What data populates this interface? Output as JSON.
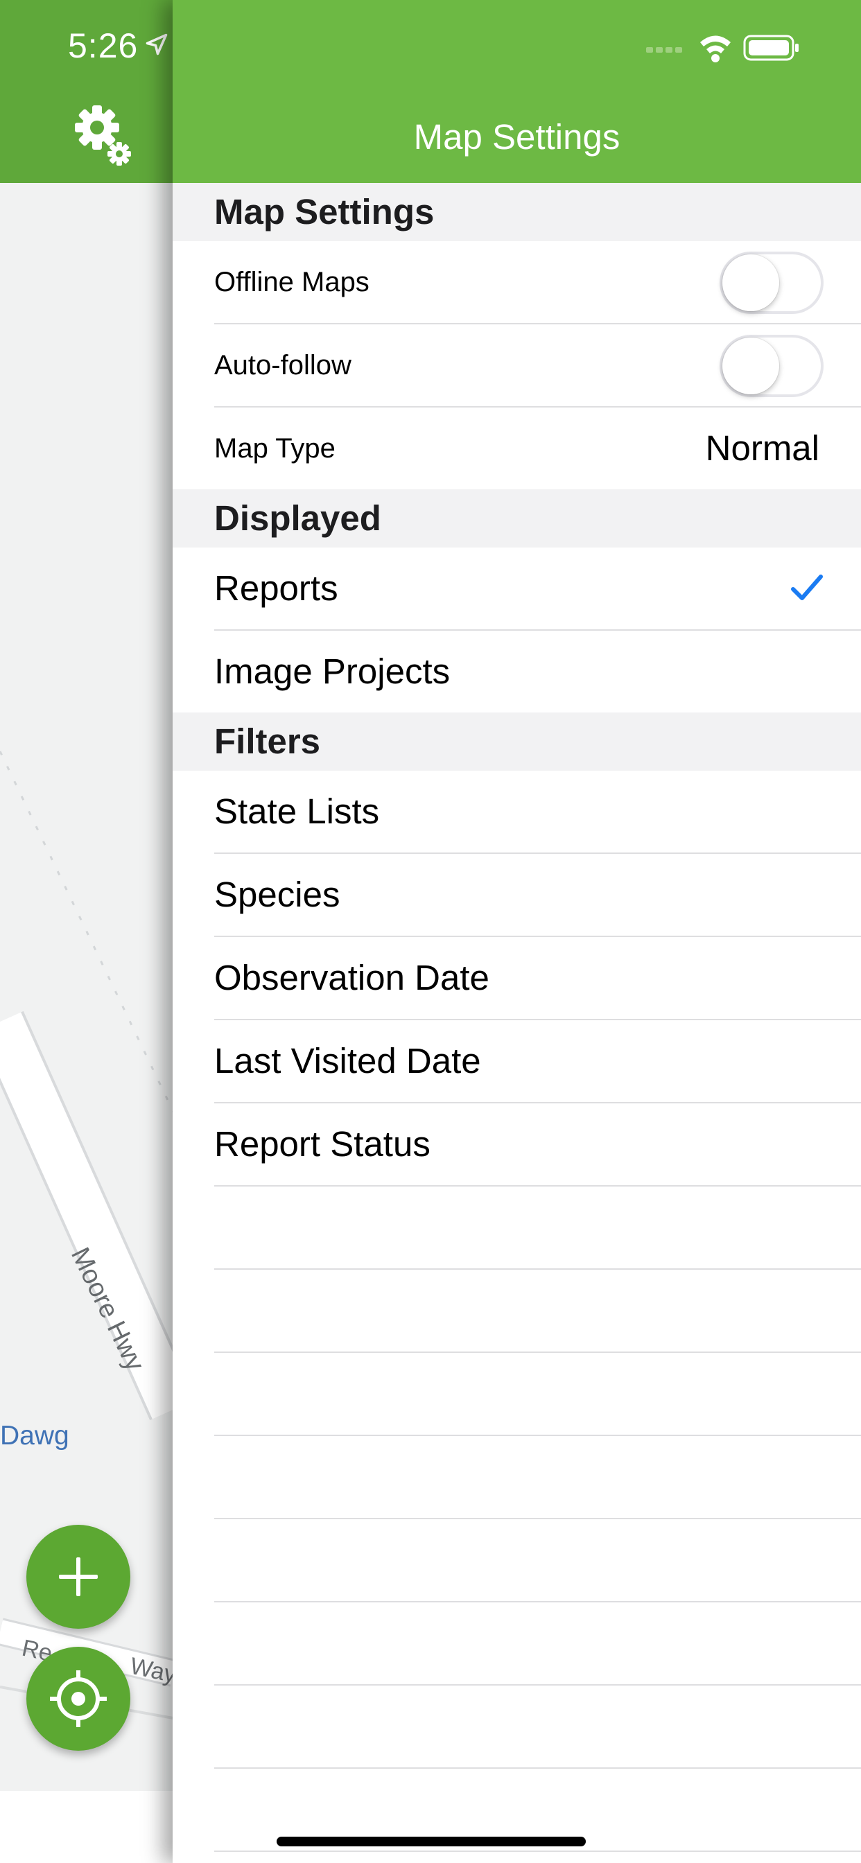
{
  "status_bar": {
    "time": "5:26"
  },
  "header": {
    "title": "Map Settings"
  },
  "sections": {
    "map_settings": {
      "title": "Map Settings",
      "offline_maps": {
        "label": "Offline Maps",
        "on": false
      },
      "auto_follow": {
        "label": "Auto-follow",
        "on": false
      },
      "map_type": {
        "label": "Map Type",
        "value": "Normal"
      }
    },
    "displayed": {
      "title": "Displayed",
      "items": [
        {
          "label": "Reports",
          "checked": true
        },
        {
          "label": "Image Projects",
          "checked": false
        }
      ]
    },
    "filters": {
      "title": "Filters",
      "items": [
        {
          "label": "State Lists"
        },
        {
          "label": "Species"
        },
        {
          "label": "Observation Date"
        },
        {
          "label": "Last Visited Date"
        },
        {
          "label": "Report Status"
        }
      ]
    }
  },
  "map": {
    "road_label": "Moore Hwy",
    "place_label": "Dawg",
    "street_label_left": "Re",
    "street_label_right": "Way"
  },
  "colors": {
    "header_green": "#6db944",
    "fab_green": "#5ca832",
    "check_blue": "#1a7bf2"
  },
  "icons": {
    "settings": "gear-icon",
    "add": "plus-icon",
    "locate": "crosshair-icon",
    "location": "location-arrow-icon",
    "wifi": "wifi-icon",
    "battery": "battery-icon",
    "signal": "signal-icon",
    "check": "checkmark-icon"
  }
}
